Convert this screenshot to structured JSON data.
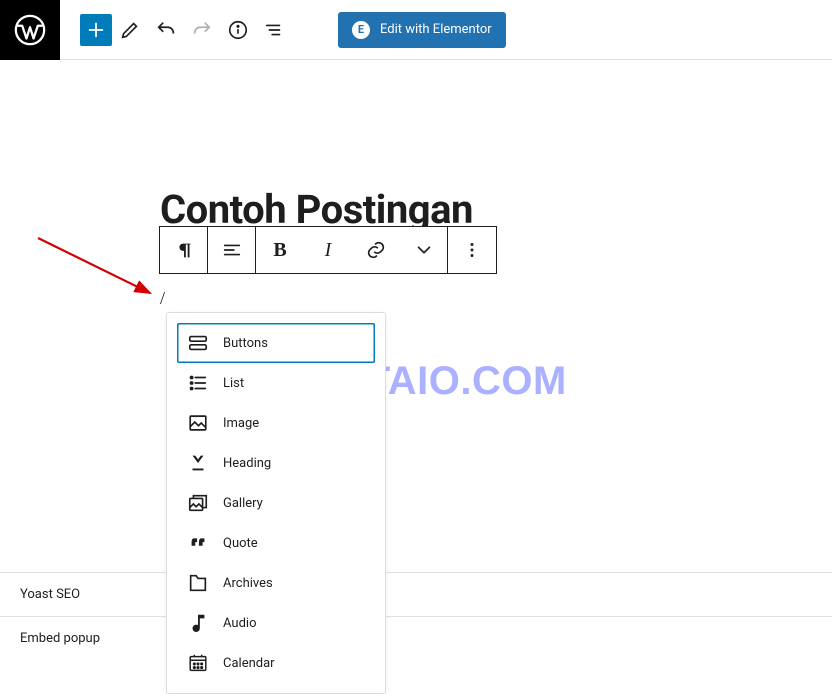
{
  "topbar": {
    "elementor_label": "Edit with Elementor"
  },
  "editor": {
    "title": "Contoh Postingan",
    "slash": "/"
  },
  "block_toolbar": {
    "bold_glyph": "B",
    "italic_glyph": "I"
  },
  "popup": {
    "items": [
      {
        "key": "buttons",
        "label": "Buttons",
        "selected": true
      },
      {
        "key": "list",
        "label": "List"
      },
      {
        "key": "image",
        "label": "Image"
      },
      {
        "key": "heading",
        "label": "Heading"
      },
      {
        "key": "gallery",
        "label": "Gallery"
      },
      {
        "key": "quote",
        "label": "Quote"
      },
      {
        "key": "archives",
        "label": "Archives"
      },
      {
        "key": "audio",
        "label": "Audio"
      },
      {
        "key": "calendar",
        "label": "Calendar"
      }
    ]
  },
  "watermark": "KATAIO.COM",
  "panels": {
    "yoast": "Yoast SEO",
    "embed": "Embed popup"
  }
}
